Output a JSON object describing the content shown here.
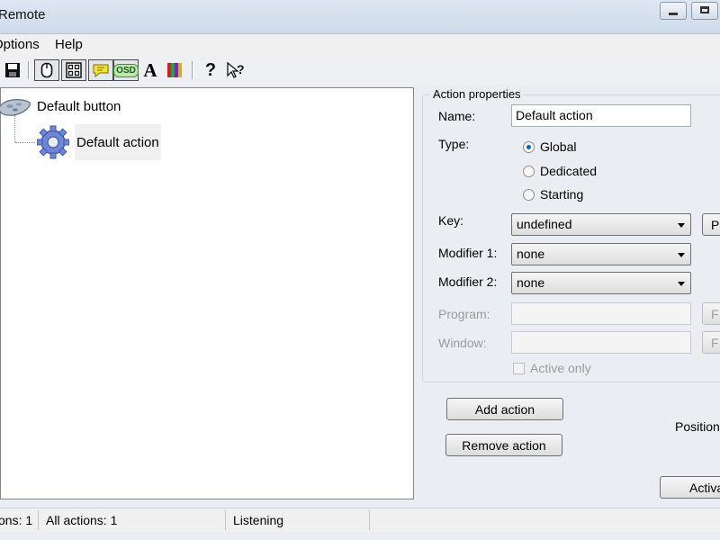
{
  "window": {
    "title": "Remote"
  },
  "menu": {
    "items": [
      "Options",
      "Help"
    ]
  },
  "toolbar": {
    "buttons": [
      {
        "icon": "save-icon"
      },
      {
        "icon": "mouse-icon",
        "pressed": true
      },
      {
        "icon": "grid-icon",
        "pressed": true
      },
      {
        "icon": "speech-bubble-icon",
        "pressed": true
      },
      {
        "icon": "osd-icon",
        "label": "OSD",
        "pressed": true
      },
      {
        "icon": "font-icon",
        "label": "A"
      },
      {
        "icon": "color-bars-icon"
      },
      {
        "icon": "help-icon",
        "label": "?"
      },
      {
        "icon": "context-help-icon",
        "label": "?"
      }
    ]
  },
  "tree": {
    "root": {
      "label": "Default button",
      "icon": "remote-control-icon"
    },
    "child": {
      "label": "Default action",
      "icon": "gear-icon"
    }
  },
  "properties": {
    "caption": "Action properties",
    "name_label": "Name:",
    "name_value": "Default action",
    "type_label": "Type:",
    "types": [
      "Global",
      "Dedicated",
      "Starting"
    ],
    "selected_type": "Global",
    "key_label": "Key:",
    "key_value": "undefined",
    "key_button_label": "P",
    "modifier1_label": "Modifier 1:",
    "modifier1_value": "none",
    "modifier2_label": "Modifier 2:",
    "modifier2_value": "none",
    "program_label": "Program:",
    "program_value": "",
    "program_button_label": "F",
    "window_label": "Window:",
    "window_value": "",
    "window_button_label": "F",
    "active_only_label": "Active only"
  },
  "actions": {
    "add_label": "Add action",
    "remove_label": "Remove action",
    "position_label": "Position:",
    "activate_label": "Activa"
  },
  "status": {
    "actions": "ons: 1",
    "all_actions": "All actions: 1",
    "state": "Listening"
  },
  "colors": {
    "titlebar": "#d6e1ee",
    "selection": "#f0f0f0",
    "radio_dot": "#1d5aa8",
    "osd_green": "#2f9a2f",
    "bubble_yellow": "#f2e635"
  }
}
